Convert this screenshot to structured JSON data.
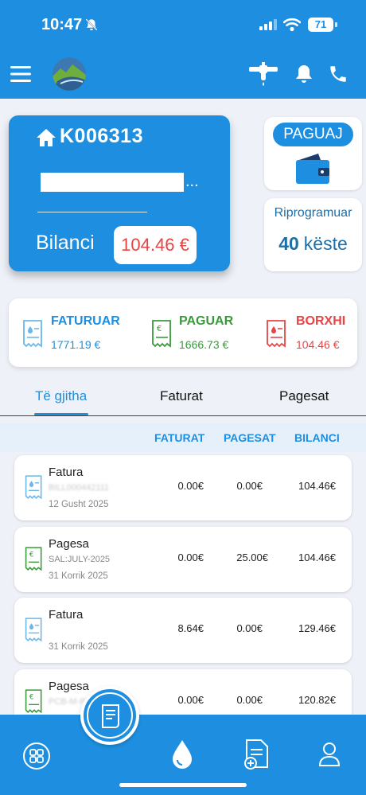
{
  "status_bar": {
    "time": "10:47",
    "battery": "71"
  },
  "header": {
    "menu_icon": "menu-icon",
    "logo": "app-logo",
    "tap_icon": "water-tap-icon",
    "bell_icon": "bell-icon",
    "phone_icon": "phone-icon"
  },
  "account": {
    "id": "K006313",
    "name_ellipsis": "...",
    "balance_label": "Bilanci",
    "balance_value": "104.46 €"
  },
  "pay": {
    "label": "PAGUAJ",
    "icon": "wallet-icon"
  },
  "reschedule": {
    "title": "Riprogramuar",
    "count": "40",
    "unit": "këste"
  },
  "summary": {
    "billed": {
      "label": "FATURUAR",
      "value": "1771.19 €",
      "color": "#1e8fe0"
    },
    "paid": {
      "label": "PAGUAR",
      "value": "1666.73 €",
      "color": "#3a9a3a"
    },
    "debt": {
      "label": "BORXHI",
      "value": "104.46 €",
      "color": "#e84444"
    }
  },
  "tabs": [
    {
      "label": "Të gjitha",
      "active": true
    },
    {
      "label": "Faturat",
      "active": false
    },
    {
      "label": "Pagesat",
      "active": false
    }
  ],
  "columns": {
    "invoices": "FATURAT",
    "payments": "PAGESAT",
    "balance": "BILANCI"
  },
  "rows": [
    {
      "type": "Fatura",
      "ref": "BILL000442111",
      "date": "12 Gusht 2025",
      "invoice": "0.00€",
      "payment": "0.00€",
      "balance": "104.46€",
      "kind": "invoice"
    },
    {
      "type": "Pagesa",
      "ref": "SAL:JULY-2025",
      "date": "31 Korrik 2025",
      "invoice": "0.00€",
      "payment": "25.00€",
      "balance": "104.46€",
      "kind": "payment"
    },
    {
      "type": "Fatura",
      "ref": "",
      "date": "31 Korrik 2025",
      "invoice": "8.64€",
      "payment": "0.00€",
      "balance": "129.46€",
      "kind": "invoice"
    },
    {
      "type": "Pagesa",
      "ref": "PCB-M-P-000001",
      "date": "",
      "invoice": "0.00€",
      "payment": "0.00€",
      "balance": "120.82€",
      "kind": "payment"
    }
  ],
  "bottom_nav": [
    "dashboard-icon",
    "bills-icon",
    "water-drop-icon",
    "add-document-icon",
    "profile-icon"
  ]
}
